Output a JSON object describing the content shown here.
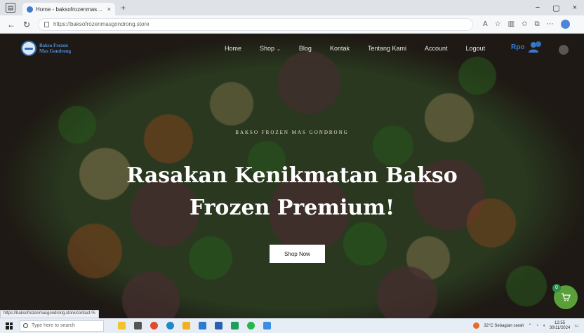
{
  "browser": {
    "tab_title": "Home - baksofrozenmasgondrong",
    "tab_close": "×",
    "new_tab": "+",
    "url": "https://baksofrozenmasgondrong.store",
    "window_controls": [
      "−",
      "▢",
      "×"
    ]
  },
  "site": {
    "logo_line1": "Bakso Frozen",
    "logo_line2": "Mas Gondrong",
    "menu": [
      {
        "label": "Home"
      },
      {
        "label": "Shop"
      },
      {
        "label": "Blog"
      },
      {
        "label": "Kontak"
      },
      {
        "label": "Tentang Kami"
      },
      {
        "label": "Account"
      },
      {
        "label": "Logout"
      }
    ],
    "user_name": "Rpo"
  },
  "hero": {
    "eyebrow": "BAKSO FROZEN MAS GONDRONG",
    "headline_line1": "Rasakan Kenikmatan Bakso",
    "headline_line2": "Frozen Premium!",
    "cta": "Shop Now"
  },
  "cart": {
    "count": "0"
  },
  "status_bar_url": "https://baksofrozenmasgondrong.store/contact-%",
  "taskbar": {
    "search_placeholder": "Type here to search",
    "weather": "32°C Sebagian cerah",
    "time": "12:55",
    "date": "30/11/2024"
  },
  "colors": {
    "brand_blue": "#3a78d0",
    "cart_green": "#5aa03a"
  }
}
